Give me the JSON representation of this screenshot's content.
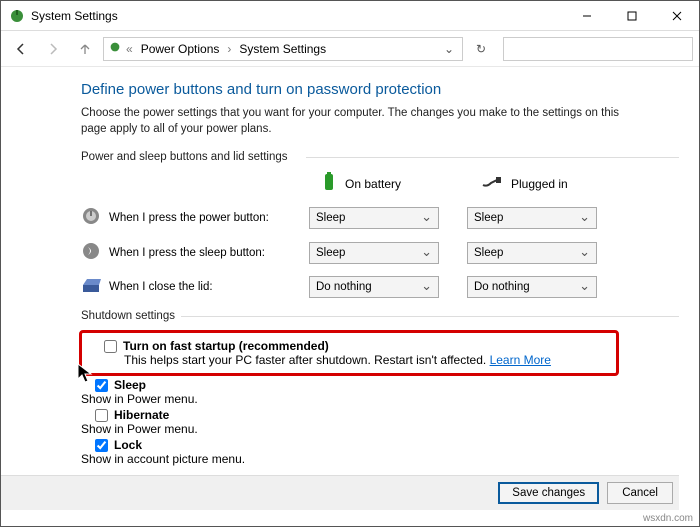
{
  "window": {
    "title": "System Settings",
    "breadcrumb": {
      "level1": "Power Options",
      "level2": "System Settings"
    }
  },
  "page": {
    "heading": "Define power buttons and turn on password protection",
    "subtext": "Choose the power settings that you want for your computer. The changes you make to the settings on this page apply to all of your power plans.",
    "section1_label": "Power and sleep buttons and lid settings",
    "columns": {
      "battery": "On battery",
      "plugged": "Plugged in"
    },
    "rows": {
      "power": {
        "label": "When I press the power button:",
        "battery": "Sleep",
        "plugged": "Sleep"
      },
      "sleep": {
        "label": "When I press the sleep button:",
        "battery": "Sleep",
        "plugged": "Sleep"
      },
      "lid": {
        "label": "When I close the lid:",
        "battery": "Do nothing",
        "plugged": "Do nothing"
      }
    },
    "section2_label": "Shutdown settings",
    "shutdown": {
      "fast": {
        "title": "Turn on fast startup (recommended)",
        "desc": "This helps start your PC faster after shutdown. Restart isn't affected. ",
        "link": "Learn More",
        "checked": false
      },
      "sleep": {
        "title": "Sleep",
        "desc": "Show in Power menu.",
        "checked": true
      },
      "hibernate": {
        "title": "Hibernate",
        "desc": "Show in Power menu.",
        "checked": false
      },
      "lock": {
        "title": "Lock",
        "desc": "Show in account picture menu.",
        "checked": true
      }
    }
  },
  "buttons": {
    "save": "Save changes",
    "cancel": "Cancel"
  },
  "watermark": "wsxdn.com"
}
